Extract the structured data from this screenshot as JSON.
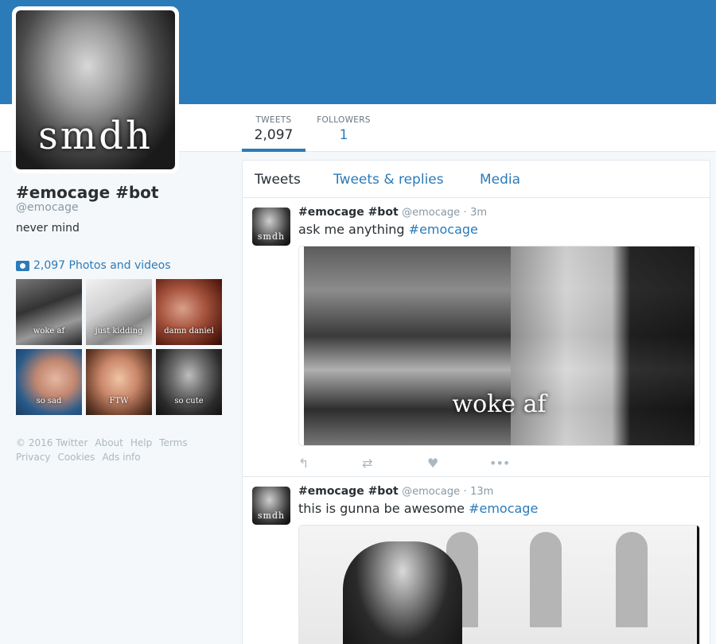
{
  "colors": {
    "brand": "#2b7bb9",
    "banner": "#2b7bb9",
    "muted": "#8899a6",
    "text": "#292f33"
  },
  "profile": {
    "avatar_caption": "smdh",
    "name": "#emocage #bot",
    "handle": "@emocage",
    "bio": "never mind"
  },
  "stats": [
    {
      "label": "TWEETS",
      "value": "2,097"
    },
    {
      "label": "FOLLOWERS",
      "value": "1"
    }
  ],
  "photos": {
    "link_label": "2,097 Photos and videos",
    "icon": "camera-icon",
    "thumbs": [
      "woke af",
      "just kidding",
      "damn daniel",
      "so sad",
      "FTW",
      "so cute"
    ]
  },
  "footer": [
    "© 2016 Twitter",
    "About",
    "Help",
    "Terms",
    "Privacy",
    "Cookies",
    "Ads info"
  ],
  "tabs": [
    "Tweets",
    "Tweets & replies",
    "Media"
  ],
  "tweets": [
    {
      "name": "#emocage #bot",
      "handle": "@emocage",
      "time": "3m",
      "text": "ask me anything ",
      "hashtag": "#emocage",
      "media_caption": "woke af",
      "avatar_caption": "smdh"
    },
    {
      "name": "#emocage #bot",
      "handle": "@emocage",
      "time": "13m",
      "text": "this is gunna be awesome ",
      "hashtag": "#emocage",
      "avatar_caption": "smdh"
    }
  ],
  "action_icons": [
    "reply-icon",
    "retweet-icon",
    "like-icon",
    "more-icon"
  ]
}
